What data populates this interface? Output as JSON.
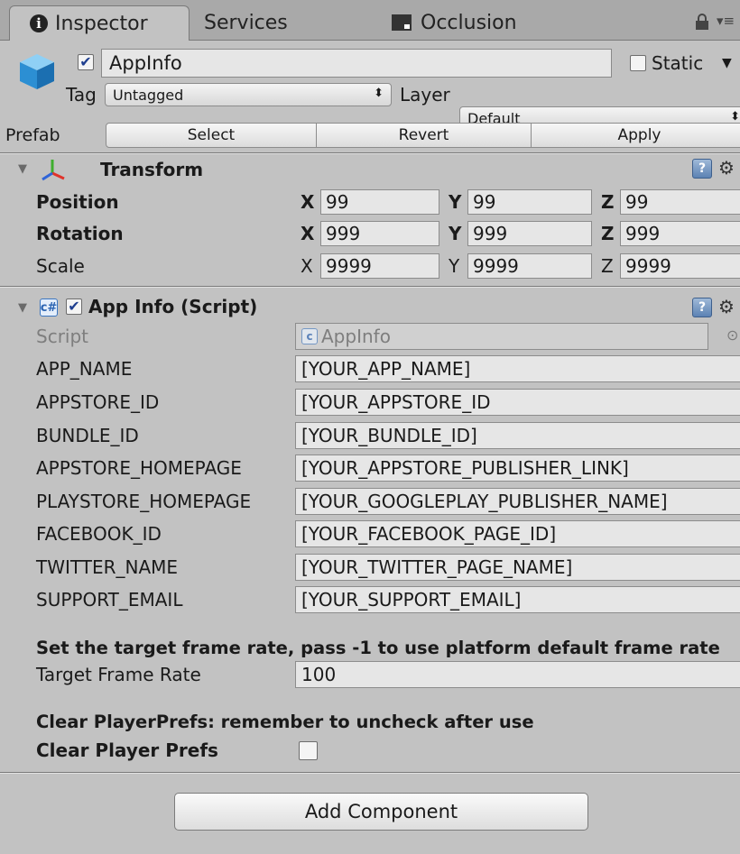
{
  "tabs": [
    {
      "label": "Inspector",
      "icon": "info-icon",
      "active": true
    },
    {
      "label": "Services",
      "active": false
    },
    {
      "label": "Occlusion",
      "icon": "occlusion-icon",
      "active": false
    }
  ],
  "object": {
    "enabled_check": "✔",
    "name": "AppInfo",
    "static_label": "Static",
    "tag_label": "Tag",
    "tag_value": "Untagged",
    "layer_label": "Layer",
    "layer_value": "Default"
  },
  "prefab": {
    "label": "Prefab",
    "select": "Select",
    "revert": "Revert",
    "apply": "Apply"
  },
  "transform": {
    "title": "Transform",
    "rows": [
      {
        "label": "Position",
        "x": "99",
        "y": "99",
        "z": "99"
      },
      {
        "label": "Rotation",
        "x": "999",
        "y": "999",
        "z": "999"
      },
      {
        "label": "Scale",
        "x": "9999",
        "y": "9999",
        "z": "9999"
      }
    ],
    "axis": {
      "x": "X",
      "y": "Y",
      "z": "Z"
    }
  },
  "script_component": {
    "title": "App Info (Script)",
    "enabled_check": "✔",
    "script_label": "Script",
    "script_value": "AppInfo",
    "fields": [
      {
        "label": "APP_NAME",
        "value": "[YOUR_APP_NAME]"
      },
      {
        "label": "APPSTORE_ID",
        "value": "[YOUR_APPSTORE_ID"
      },
      {
        "label": "BUNDLE_ID",
        "value": "[YOUR_BUNDLE_ID]"
      },
      {
        "label": "APPSTORE_HOMEPAGE",
        "value": "[YOUR_APPSTORE_PUBLISHER_LINK]"
      },
      {
        "label": "PLAYSTORE_HOMEPAGE",
        "value": "[YOUR_GOOGLEPLAY_PUBLISHER_NAME]"
      },
      {
        "label": "FACEBOOK_ID",
        "value": "[YOUR_FACEBOOK_PAGE_ID]"
      },
      {
        "label": "TWITTER_NAME",
        "value": "[YOUR_TWITTER_PAGE_NAME]"
      },
      {
        "label": "SUPPORT_EMAIL",
        "value": "[YOUR_SUPPORT_EMAIL]"
      }
    ],
    "frame_rate_header": "Set the target frame rate, pass -1 to use platform default frame rate",
    "frame_rate_label": "Target Frame Rate",
    "frame_rate_value": "100",
    "prefs_header": "Clear PlayerPrefs: remember to uncheck after use",
    "prefs_label": "Clear Player Prefs"
  },
  "add_component": "Add Component",
  "colors": {
    "panel_bg": "#c2c2c2",
    "tab_strip_bg": "#a9a9a9",
    "field_bg": "#e6e6e6",
    "check_blue": "#1f3f8f"
  }
}
